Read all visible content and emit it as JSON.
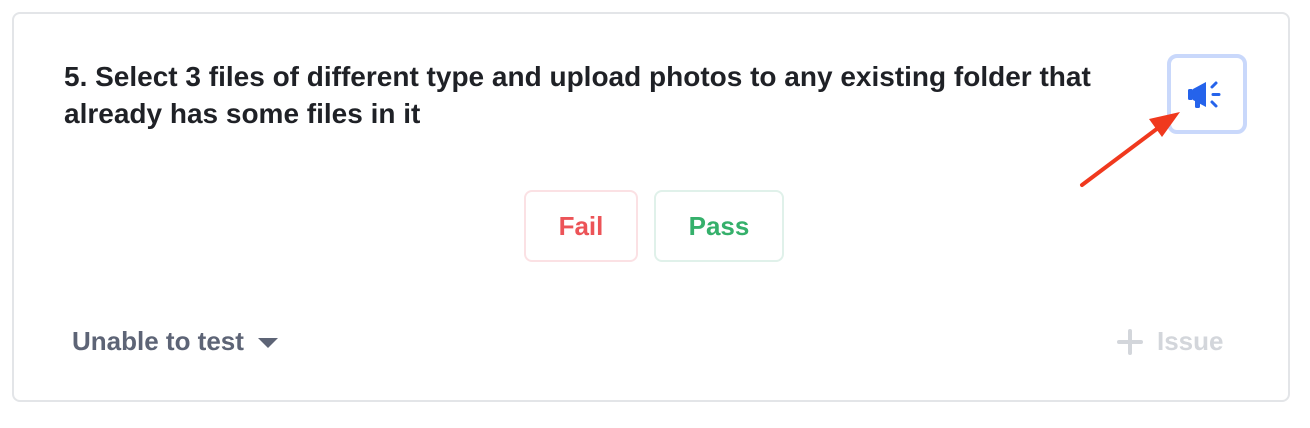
{
  "test_case": {
    "title": "5. Select 3 files of different type and upload photos to any existing folder that already has some files in it"
  },
  "actions": {
    "announce_icon": "megaphone-icon",
    "fail_label": "Fail",
    "pass_label": "Pass"
  },
  "footer": {
    "status_label": "Unable to test",
    "issue_label": "Issue"
  },
  "colors": {
    "accent": "#2563eb",
    "fail": "#ec5458",
    "pass": "#35b06b",
    "annotation_arrow": "#f0391e"
  }
}
